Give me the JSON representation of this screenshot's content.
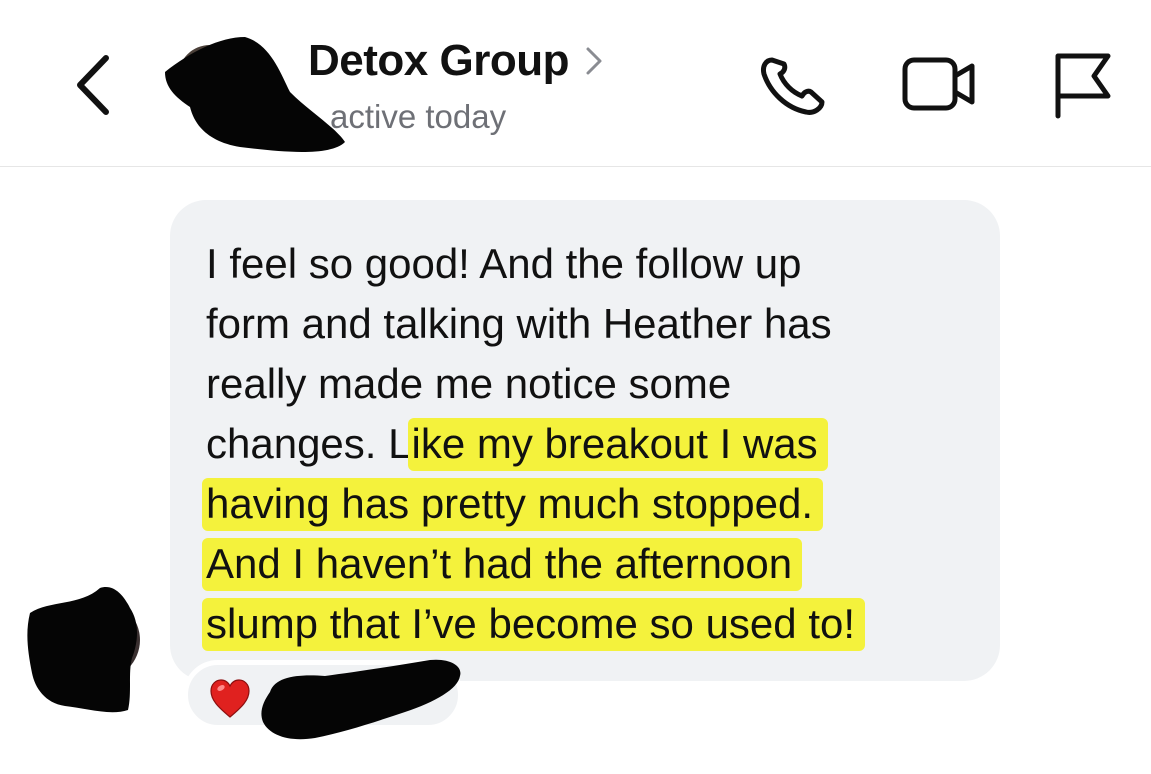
{
  "header": {
    "title": "Detox Group",
    "subtitle": "active today",
    "back_icon": "chevron-left-icon",
    "title_chevron_icon": "chevron-right-icon",
    "actions": [
      {
        "name": "call-button",
        "icon": "phone-icon"
      },
      {
        "name": "video-call-button",
        "icon": "video-camera-icon"
      },
      {
        "name": "report-button",
        "icon": "flag-icon"
      }
    ]
  },
  "message": {
    "lines": [
      {
        "text": "I feel so good! And the follow up",
        "highlighted": false
      },
      {
        "text": "form and talking with Heather has",
        "highlighted": false
      },
      {
        "text": "really made me notice some",
        "highlighted": false
      },
      {
        "pre": "changes. L",
        "text": "ike my breakout I was",
        "highlighted": true
      },
      {
        "text": "having has pretty much stopped.",
        "highlighted": true
      },
      {
        "text": "And I haven’t had the afternoon",
        "highlighted": true
      },
      {
        "text": "slump that I’ve become so used to!",
        "highlighted": true
      }
    ],
    "highlight_color": "#f4f23c",
    "bubble_color": "#f0f2f4"
  },
  "reaction": {
    "emoji": "❤️",
    "icon": "heart-icon"
  },
  "colors": {
    "text": "#111111",
    "muted": "#6e7076",
    "redaction": "#000000"
  }
}
